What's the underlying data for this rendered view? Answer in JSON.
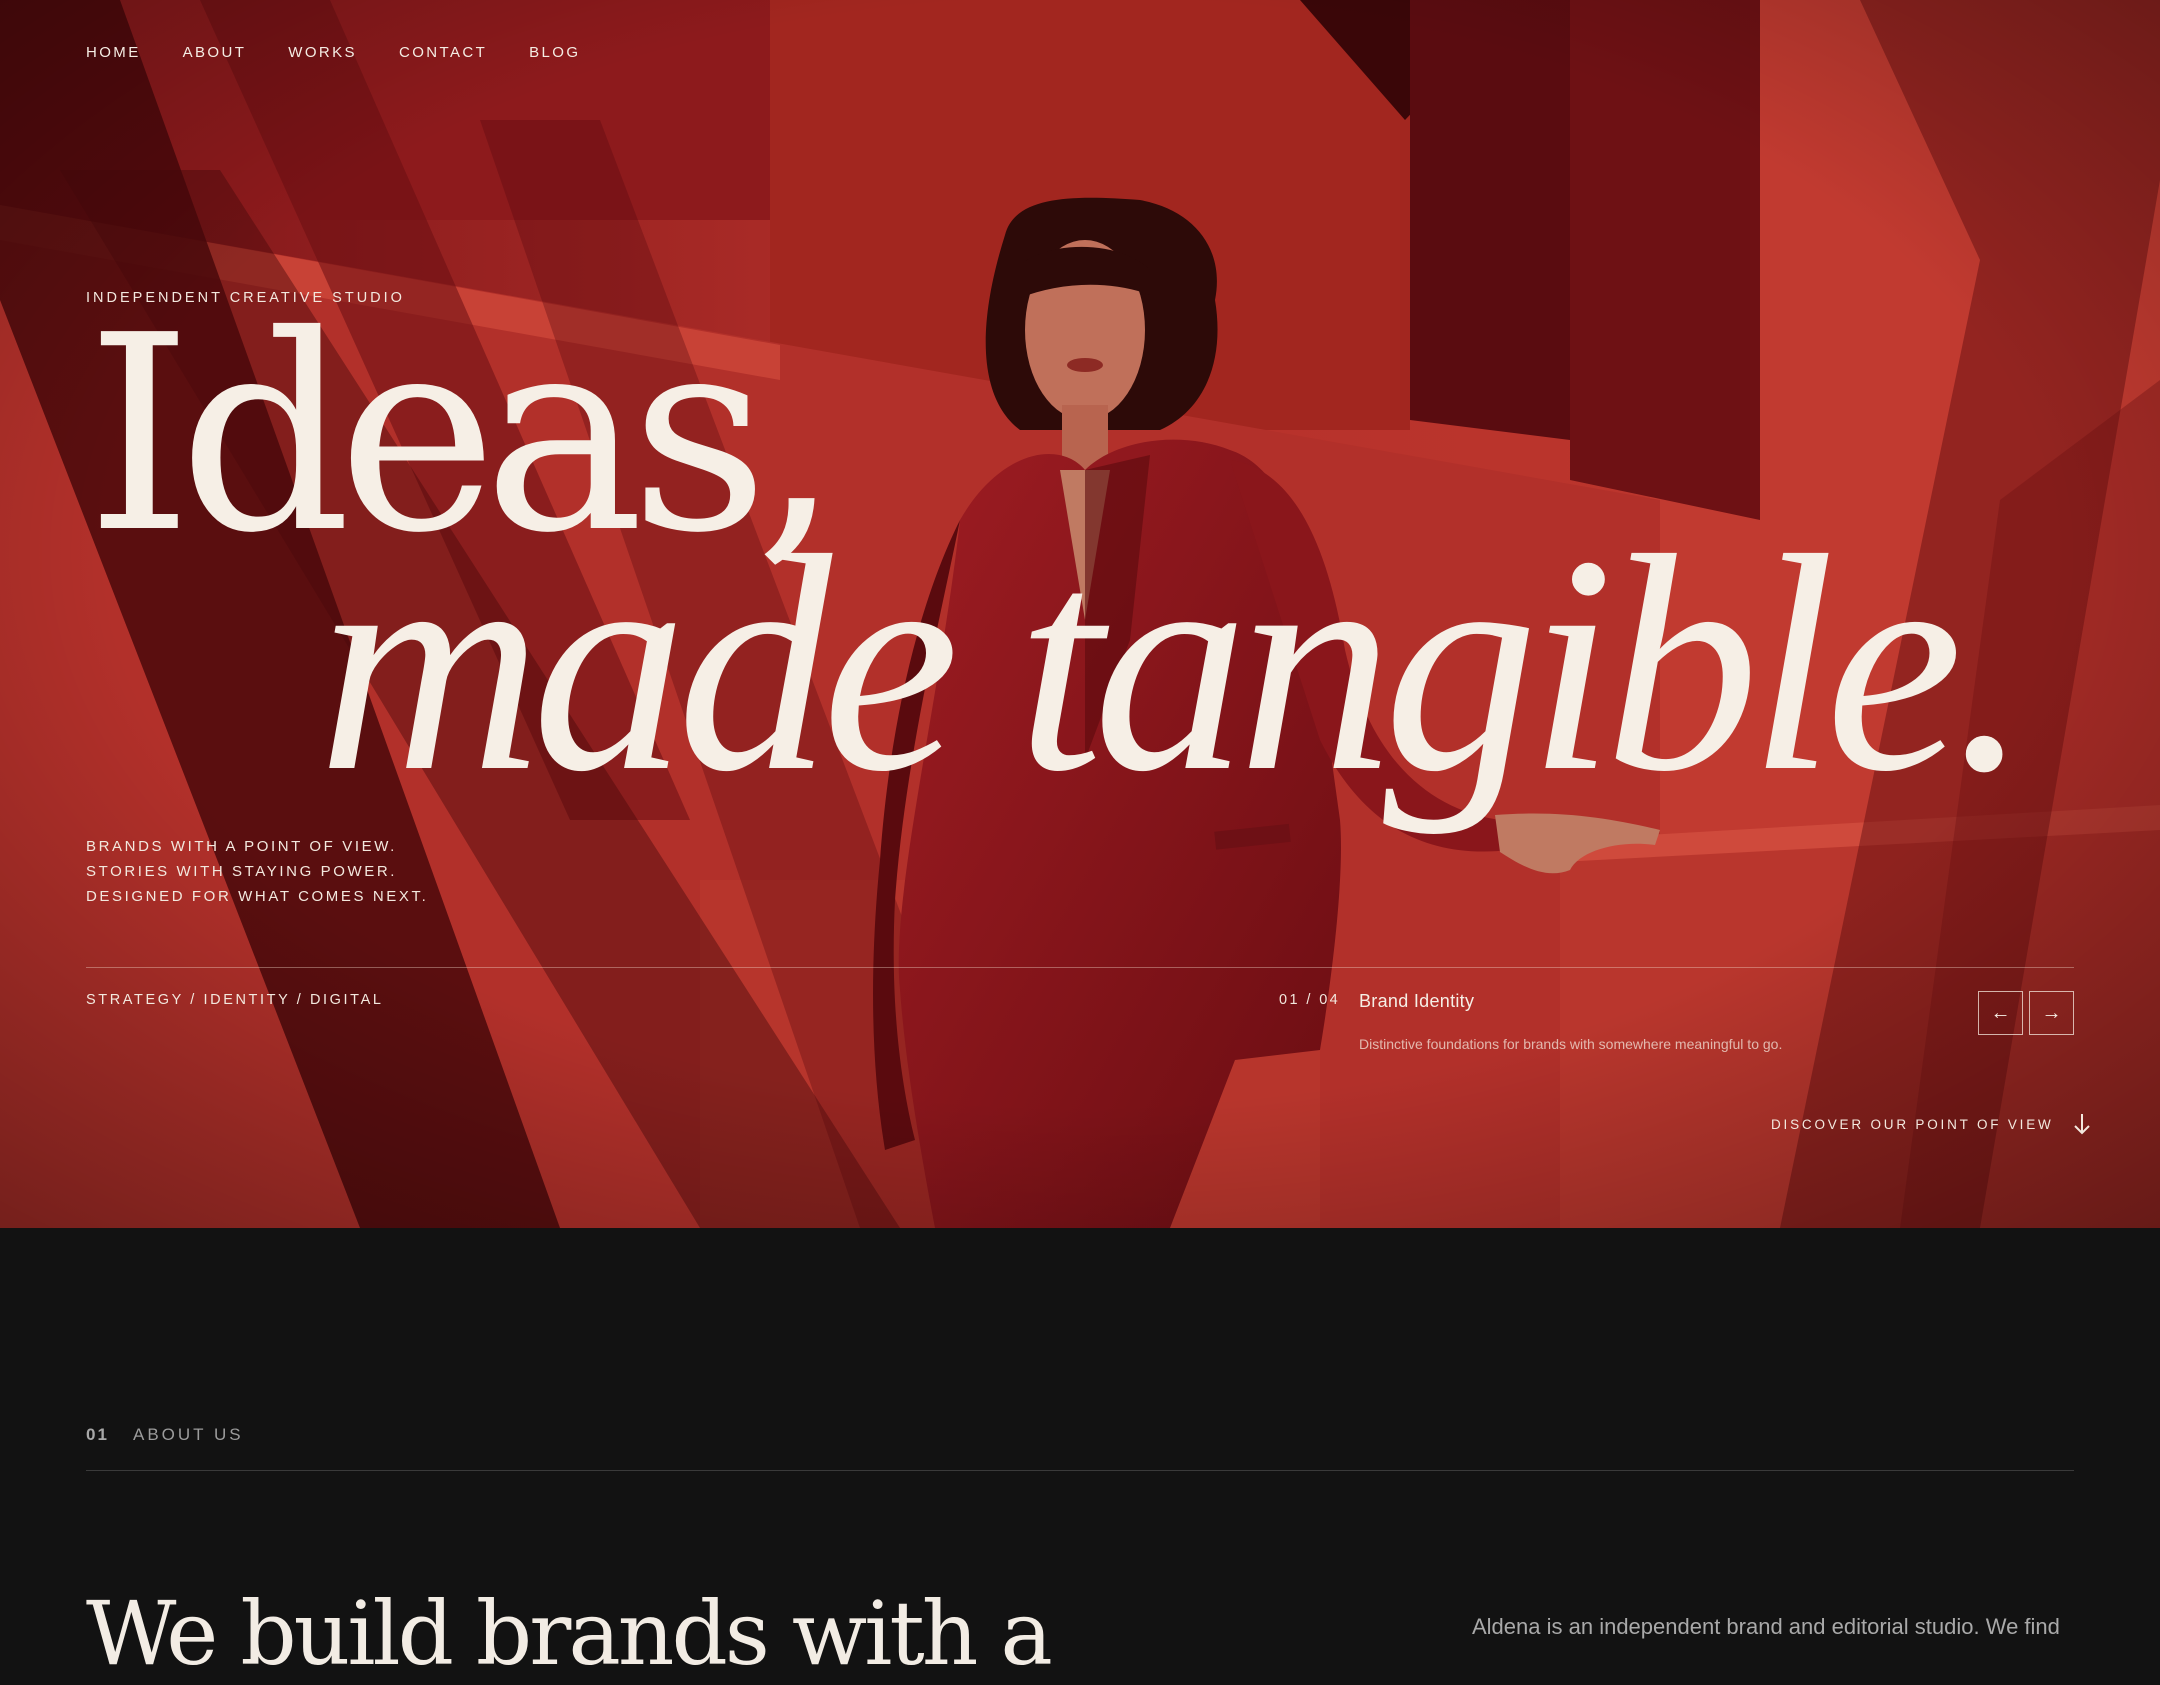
{
  "nav": {
    "items": [
      "HOME",
      "ABOUT",
      "WORKS",
      "CONTACT",
      "BLOG"
    ]
  },
  "hero": {
    "eyebrow": "INDEPENDENT CREATIVE STUDIO",
    "headline_line1": "Ideas,",
    "headline_line2": "made tangible.",
    "tagline": [
      "BRANDS WITH A POINT OF VIEW.",
      "STORIES WITH STAYING POWER.",
      "DESIGNED FOR WHAT COMES NEXT."
    ],
    "services": "STRATEGY / IDENTITY / DIGITAL",
    "slide": {
      "counter": "01 / 04",
      "title": "Brand Identity",
      "description": "Distinctive foundations for brands with somewhere meaningful to go."
    },
    "prev_label": "←",
    "next_label": "→",
    "discover_label": "DISCOVER OUR POINT OF VIEW",
    "discover_icon": "arrow-down-icon"
  },
  "about": {
    "index": "01",
    "label": "ABOUT US",
    "heading": "We build brands with a",
    "text": "Aldena is an independent brand and editorial studio. We find"
  },
  "colors": {
    "hero_red": "#b8322a",
    "deep_red": "#4e0a0c",
    "cream": "#f6efe6",
    "dark": "#121212"
  }
}
